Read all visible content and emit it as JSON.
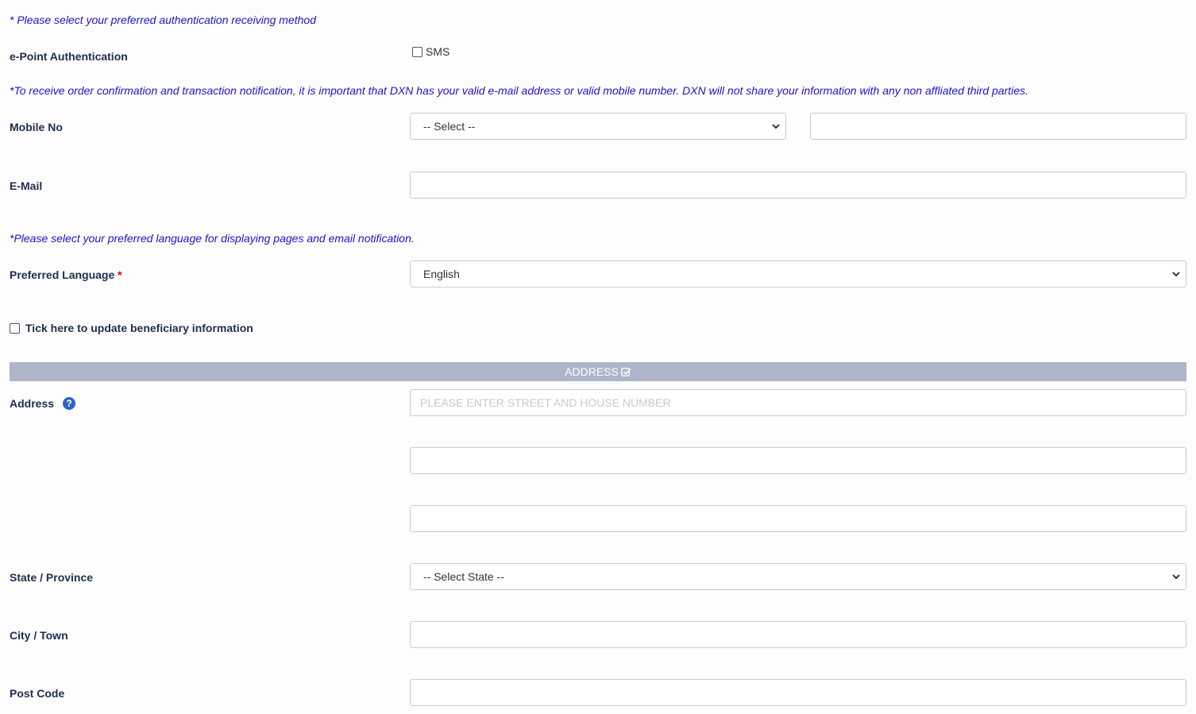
{
  "notes": {
    "auth_method": "* Please select your preferred authentication receiving method",
    "contact": "*To receive order confirmation and transaction notification, it is important that DXN has your valid e-mail address or valid mobile number. DXN will not share your information with any non affliated third parties.",
    "language": "*Please select your preferred language for displaying pages and email notification."
  },
  "epoint": {
    "label": "e-Point Authentication",
    "sms_label": "SMS",
    "sms_checked": false
  },
  "mobile": {
    "label": "Mobile No",
    "country_code_selected": "-- Select --",
    "number_value": ""
  },
  "email": {
    "label": "E-Mail",
    "value": ""
  },
  "language": {
    "label": "Preferred Language",
    "required_mark": "*",
    "selected": "English"
  },
  "beneficiary": {
    "label": "Tick here to update beneficiary information",
    "checked": false
  },
  "address_section": {
    "title": "ADDRESS",
    "icon": "edit-check-icon",
    "bar_color": "#acb6c8"
  },
  "address": {
    "label": "Address",
    "help_glyph": "?",
    "line1_placeholder": "PLEASE ENTER STREET AND HOUSE NUMBER",
    "line1_value": "",
    "line2_value": "",
    "line3_value": ""
  },
  "state": {
    "label": "State / Province",
    "selected": "-- Select State --"
  },
  "city": {
    "label": "City / Town",
    "value": ""
  },
  "postcode": {
    "label": "Post Code",
    "value": ""
  },
  "colors": {
    "note_text": "#1c14c9",
    "label_text": "#1f2d4d",
    "required": "#d90000",
    "help_icon": "#2f63c5"
  }
}
